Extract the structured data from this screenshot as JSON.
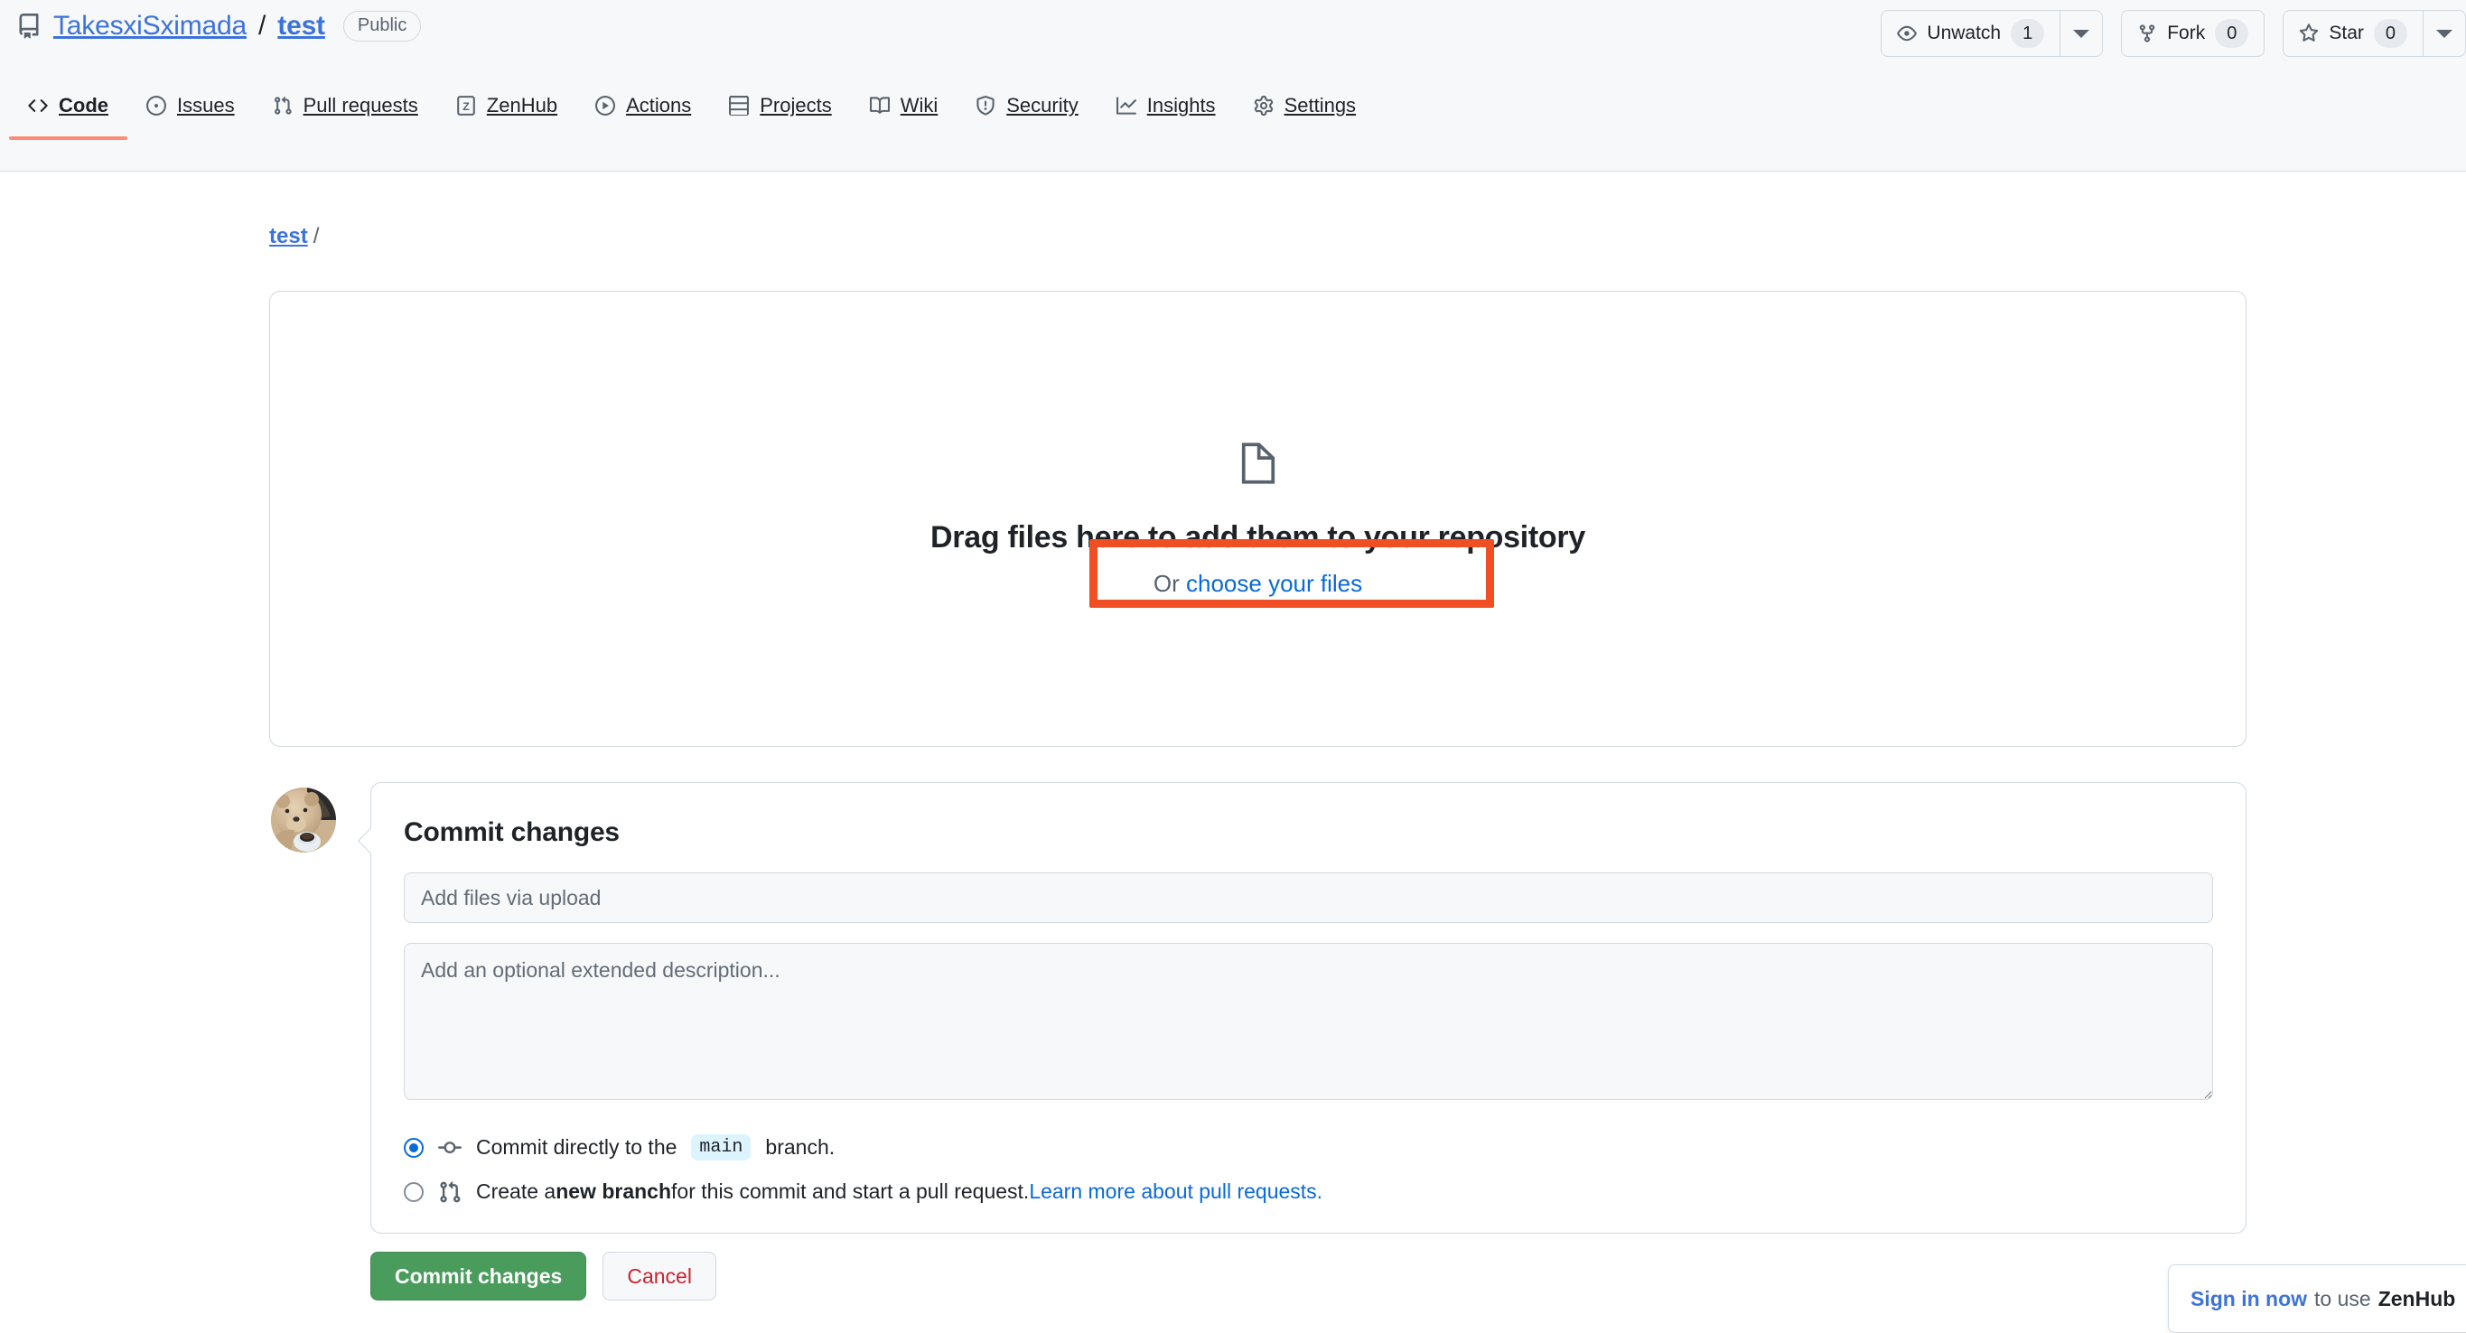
{
  "header": {
    "repo_icon": "repo-icon",
    "owner": "TakesxiSximada",
    "separator": "/",
    "name": "test",
    "visibility": "Public",
    "actions": [
      {
        "icon": "eye-icon",
        "label": "Unwatch",
        "count": "1",
        "has_dropdown": true
      },
      {
        "icon": "fork-icon",
        "label": "Fork",
        "count": "0",
        "has_dropdown": false
      },
      {
        "icon": "star-icon",
        "label": "Star",
        "count": "0",
        "has_dropdown": true
      }
    ]
  },
  "nav": {
    "tabs": [
      {
        "label": "Code",
        "icon": "code-icon",
        "active": true
      },
      {
        "label": "Issues",
        "icon": "issue-icon",
        "active": false
      },
      {
        "label": "Pull requests",
        "icon": "pr-icon",
        "active": false
      },
      {
        "label": "ZenHub",
        "icon": "zenhub-icon",
        "active": false
      },
      {
        "label": "Actions",
        "icon": "play-icon",
        "active": false
      },
      {
        "label": "Projects",
        "icon": "table-icon",
        "active": false
      },
      {
        "label": "Wiki",
        "icon": "book-icon",
        "active": false
      },
      {
        "label": "Security",
        "icon": "shield-icon",
        "active": false
      },
      {
        "label": "Insights",
        "icon": "graph-icon",
        "active": false
      },
      {
        "label": "Settings",
        "icon": "gear-icon",
        "active": false
      }
    ]
  },
  "breadcrumb": {
    "root": "test",
    "slash": "/"
  },
  "dropzone": {
    "icon": "file-icon",
    "title": "Drag files here to add them to your repository",
    "or_text": "Or ",
    "link_text": "choose your files"
  },
  "annotation": {
    "color": "#f04e23"
  },
  "commit": {
    "avatar_name": "user-avatar",
    "heading": "Commit changes",
    "message_placeholder": "Add files via upload",
    "message_value": "",
    "description_placeholder": "Add an optional extended description...",
    "description_value": "",
    "options": [
      {
        "selected": true,
        "icon": "commit-icon",
        "text_before": "Commit directly to the ",
        "branch": "main",
        "text_after": " branch."
      },
      {
        "selected": false,
        "icon": "pr-icon",
        "text_before": "Create a ",
        "bold": "new branch",
        "text_after": " for this commit and start a pull request. ",
        "link": "Learn more about pull requests."
      }
    ],
    "submit_label": "Commit changes",
    "cancel_label": "Cancel"
  },
  "zenhub_banner": {
    "link": "Sign in now",
    "middle": "to use",
    "brand": "ZenHub"
  }
}
